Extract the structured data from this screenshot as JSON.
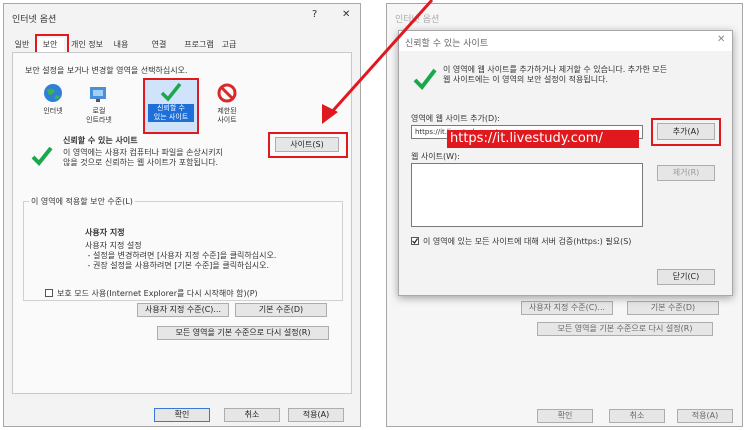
{
  "left": {
    "title": "인터넷 옵션",
    "help_glyph": "?",
    "close_glyph": "✕",
    "tabs": [
      "일반",
      "보안",
      "개인 정보",
      "내용",
      "연결",
      "프로그램",
      "고급"
    ],
    "instruction": "보안 설정을 보거나 변경할 영역을 선택하십시오.",
    "zones": [
      {
        "label": "인터넷"
      },
      {
        "label": "로컬\n인트라넷"
      },
      {
        "label": "신뢰할 수\n있는 사이트"
      },
      {
        "label": "제한된\n사이트"
      }
    ],
    "zone_heading": "신뢰할 수 있는 사이트",
    "zone_desc": "이 영역에는 사용자 컴퓨터나 파일을 손상시키지\n않을 것으로 신뢰하는 웹 사이트가 포함됩니다.",
    "sites_button": "사이트(S)",
    "level_group": "이 영역에 적용할 보안 수준(L)",
    "custom_heading": "사용자 지정",
    "custom_lines": "사용자 지정 설정\n - 설정을 변경하려면 [사용자 지정 수준]을 클릭하십시오.\n - 권장 설정을 사용하려면 [기본 수준]을 클릭하십시오.",
    "protected_mode": "보호 모드 사용(Internet Explorer를 다시 시작해야 함)(P)",
    "custom_level_button": "사용자 지정 수준(C)...",
    "default_level_button": "기본 수준(D)",
    "reset_all_button": "모든 영역을 기본 수준으로 다시 설정(R)",
    "ok": "확인",
    "cancel": "취소",
    "apply": "적용(A)"
  },
  "right": {
    "bg_title": "인터넷 옵션",
    "dialog_title": "신뢰할 수 있는 사이트",
    "close_glyph": "✕",
    "info": "이 영역에 웹 사이트를 추가하거나 제거할 수 있습니다. 추가한 모든\n웹 사이트에는 이 영역의 보안 설정이 적용됩니다.",
    "add_label": "영역에 웹 사이트 추가(D):",
    "add_value": "https://it.livestudy.com/",
    "overlay_url": "https://it.livestudy.com/",
    "add_button": "추가(A)",
    "sites_label": "웹 사이트(W):",
    "remove_button": "제거(R)",
    "https_check": "이 영역에 있는 모든 사이트에 대해 서버 검증(https:) 필요(S)",
    "close_button": "닫기(C)",
    "bg_custom_level": "사용자 지정 수준(C)...",
    "bg_default_level": "기본 수준(D)",
    "bg_reset_all": "모든 영역을 기본 수준으로 다시 설정(R)",
    "bg_ok": "확인",
    "bg_cancel": "취소",
    "bg_apply": "적용(A)"
  },
  "colors": {
    "highlight": "#e0191f",
    "check": "#1aa84a",
    "selected_zone": "#1f6fd8"
  }
}
